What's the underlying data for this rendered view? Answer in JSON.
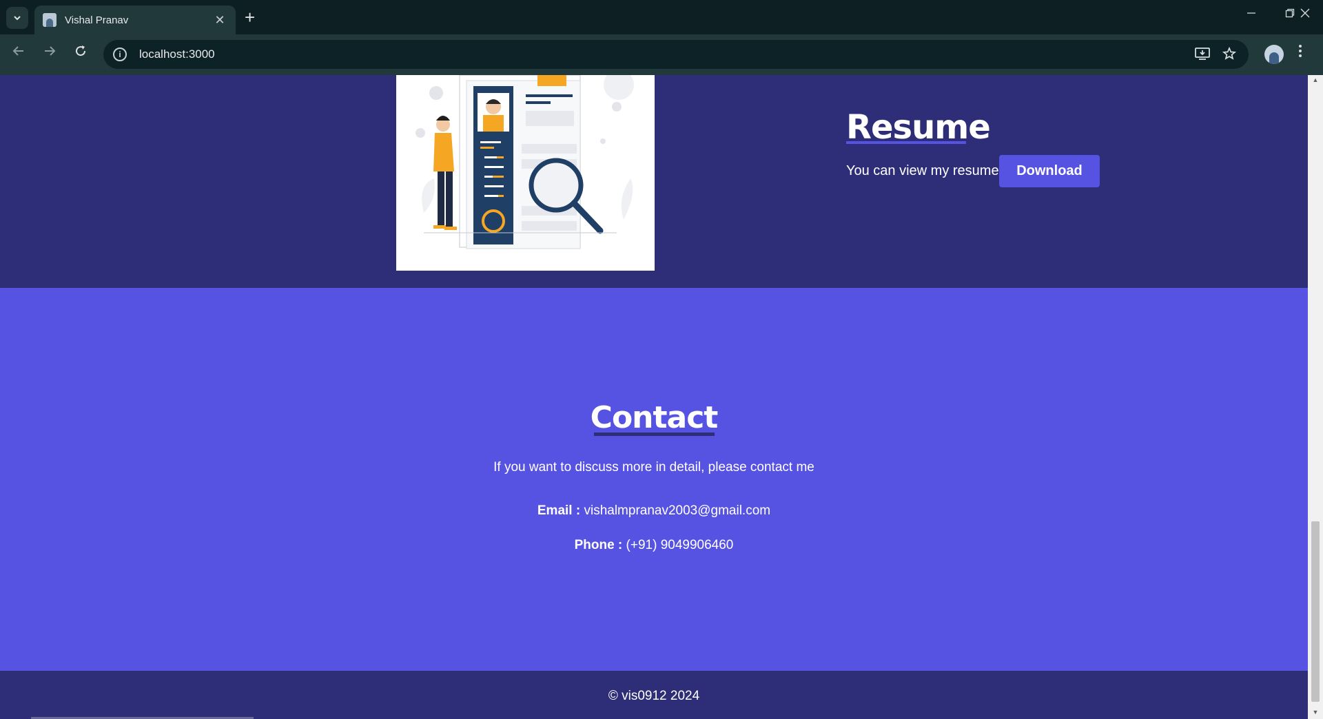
{
  "browser": {
    "tab_title": "Vishal Pranav",
    "url": "localhost:3000",
    "new_tab": "+",
    "close": "✕"
  },
  "resume": {
    "title": "Resume",
    "text": "You can view my resume",
    "download_label": "Download"
  },
  "contact": {
    "title": "Contact",
    "text": "If you want to discuss more in detail, please contact me",
    "email_label": "Email :",
    "email_value": "vishalmpranav2003@gmail.com",
    "phone_label": "Phone :",
    "phone_value": "(+91) 9049906460"
  },
  "footer": {
    "copyright": "© vis0912 2024"
  },
  "colors": {
    "dark_section": "#2e2e78",
    "accent": "#5753e2"
  }
}
